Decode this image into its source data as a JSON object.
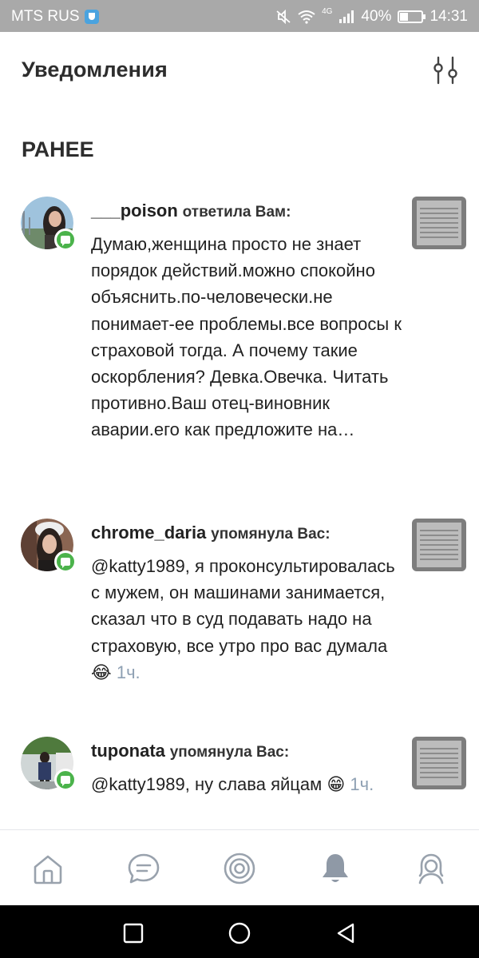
{
  "statusbar": {
    "carrier": "MTS RUS",
    "network": "4G",
    "battery": "40%",
    "battery_level": 0.4,
    "time": "14:31"
  },
  "header": {
    "title": "Уведомления",
    "filter_icon": "sliders-icon"
  },
  "section": {
    "title": "РАНЕЕ"
  },
  "notifications": [
    {
      "user": "___poison",
      "action": "ответила Вам:",
      "text": "Думаю,женщина просто не знает порядок действий.можно спокойно объяснить.по-человечески.не понимает-ее проблемы.все вопросы к страховой тогда. А почему такие оскорбления? Девка.Овечка. Читать противно.Ваш отец-виновник аварии.его как предложите на…",
      "time": ""
    },
    {
      "user": "chrome_daria",
      "action": "упомянула Вас:",
      "text": "@katty1989, я проконсультировалась с мужем, он машинами занимается, сказал что в суд подавать надо на страховую, все утро про вас думала 😂",
      "time": "1ч."
    },
    {
      "user": "tuponata",
      "action": "упомянула Вас:",
      "text": "@katty1989, ну слава яйцам 😁",
      "time": "1ч."
    }
  ],
  "bottom_nav": [
    "home-icon",
    "messages-icon",
    "discover-icon",
    "notifications-icon",
    "profile-icon"
  ],
  "system_nav": [
    "recents-button",
    "home-button",
    "back-button"
  ],
  "colors": {
    "accent_green": "#4bb34b",
    "time_gray": "#8ea0b3",
    "icon_gray": "#99a2ad"
  }
}
